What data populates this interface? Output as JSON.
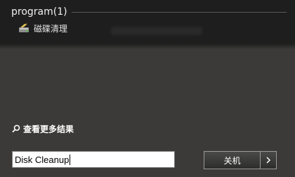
{
  "results": {
    "section_title": "program(1)",
    "items": [
      {
        "label": "磁碟清理",
        "icon": "disk-cleanup-icon"
      }
    ]
  },
  "see_more": {
    "label": "查看更多结果",
    "icon": "search-icon"
  },
  "search": {
    "value": "Disk Cleanup"
  },
  "shutdown": {
    "label": "关机",
    "arrow_icon": "chevron-right-icon"
  }
}
